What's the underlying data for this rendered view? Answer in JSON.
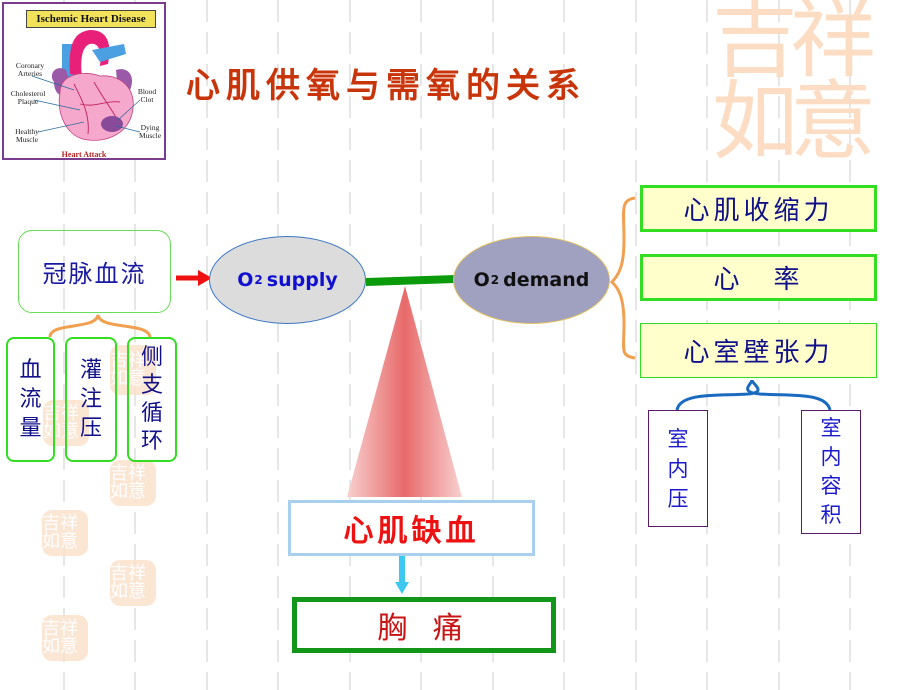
{
  "slide": {
    "title": "心肌供氧与需氧的关系",
    "watermark": "吉祥如意",
    "figure": {
      "title": "Ischemic Heart Disease",
      "labels": {
        "coronary_arteries": "Coronary Arteries",
        "cholesterol_plaque": "Cholesterol Plaque",
        "healthy_muscle": "Healthy Muscle",
        "blood_clot": "Blood Clot",
        "dying_muscle": "Dying Muscle"
      },
      "caption": "Heart Attack"
    },
    "supply_side": {
      "main": "冠脉血流",
      "factors": [
        {
          "chars": [
            "血",
            "流",
            "量"
          ]
        },
        {
          "chars": [
            "灌",
            "注",
            "压"
          ]
        },
        {
          "chars": [
            "侧",
            "支",
            "循",
            "环"
          ]
        }
      ]
    },
    "supply_node": {
      "prefix": "O",
      "subscript": "2",
      "label": "supply"
    },
    "demand_node": {
      "prefix": "O",
      "subscript": "2",
      "label": "demand"
    },
    "demand_side": {
      "factors": [
        "心肌收缩力",
        "心　率",
        "心室壁张力"
      ],
      "wall_tension_factors": [
        {
          "chars": [
            "室",
            "内",
            "压"
          ]
        },
        {
          "chars": [
            "室",
            "内",
            "容",
            "积"
          ]
        }
      ]
    },
    "outcome": {
      "ischemia": "心肌缺血",
      "symptom": "胸 痛"
    },
    "colors": {
      "title": "#c8350a",
      "balance_bar": "#0a9a0a",
      "arrow_red": "#ee1111",
      "arrow_blue": "#3cc8f0",
      "brace_orange": "#f0a050",
      "brace_blue": "#1a6ac0"
    }
  }
}
